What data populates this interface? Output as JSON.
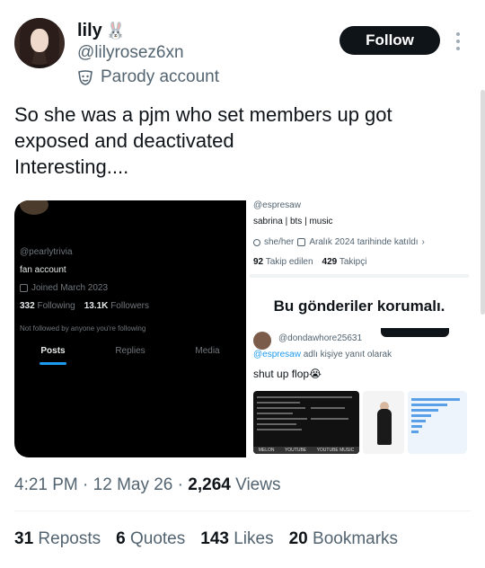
{
  "author": {
    "display_name": "lily",
    "name_emoji": "🐰",
    "handle": "@lilyrosez6xn",
    "label": "Parody account"
  },
  "actions": {
    "follow_label": "Follow"
  },
  "tweet": {
    "lines": [
      "So she was a pjm who set members up got",
      "exposed and deactivated",
      "Interesting...."
    ]
  },
  "media": {
    "left": {
      "username": "@pearlytrivia",
      "bio": "fan account",
      "joined": "Joined March 2023",
      "following_count": "332",
      "following_label": "Following",
      "followers_count": "13.1K",
      "followers_label": "Followers",
      "not_followed": "Not followed by anyone you're following",
      "tabs": [
        "Posts",
        "Replies",
        "Media"
      ]
    },
    "right": {
      "handle": "@espresaw",
      "bio": "sabrina | bts | music",
      "pronouns": "she/her",
      "joined": "Aralık 2024 tarihinde katıldı",
      "following_count": "92",
      "following_label": "Takip edilen",
      "followers_count": "429",
      "followers_label": "Takipçi",
      "protected_notice": "Bu gönderiler korumalı.",
      "reply_user": "@dondawhore25631",
      "reply_to_handle": "@espresaw",
      "reply_to_suffix": "adlı kişiye yanıt olarak",
      "reply_text": "shut up flop😭",
      "thumb_labels": [
        "MELON",
        "YOUTUBE",
        "YOUTUBE MUSIC"
      ]
    }
  },
  "meta": {
    "time": "4:21 PM",
    "date": "12 May 26",
    "views_count": "2,264",
    "views_label": "Views"
  },
  "engagement": {
    "reposts_count": "31",
    "reposts_label": "Reposts",
    "quotes_count": "6",
    "quotes_label": "Quotes",
    "likes_count": "143",
    "likes_label": "Likes",
    "bookmarks_count": "20",
    "bookmarks_label": "Bookmarks"
  }
}
